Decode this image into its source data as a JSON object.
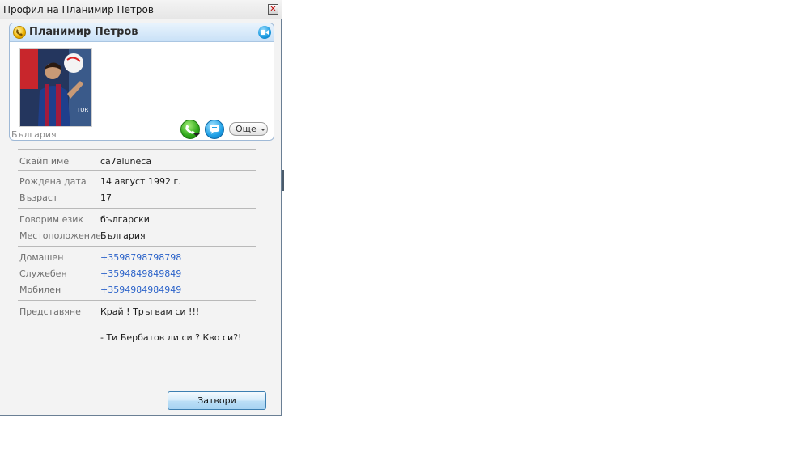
{
  "window": {
    "title": "Профил на Планимир Петров",
    "close_glyph": "✕"
  },
  "card": {
    "name": "Планимир Петров",
    "country": "България",
    "more_label": "Още",
    "status_icon": "phone-status-icon",
    "video_icon": "video-icon"
  },
  "fields": {
    "skype_name": {
      "label": "Скайп име",
      "value": "ca7aluneca"
    },
    "birth_date": {
      "label": "Рождена дата",
      "value": "14 август 1992 г."
    },
    "age": {
      "label": "Възраст",
      "value": "17"
    },
    "language": {
      "label": "Говорим език",
      "value": "български"
    },
    "location": {
      "label": "Местоположение",
      "value": "България"
    },
    "home_phone": {
      "label": "Домашен",
      "value": "+3598798798798"
    },
    "office_phone": {
      "label": "Служебен",
      "value": "+3594849849849"
    },
    "mobile_phone": {
      "label": "Мобилен",
      "value": "+3594984984949"
    },
    "intro": {
      "label": "Представяне",
      "line1": "Край ! Тръгвам си !!!",
      "line2": "- Ти Бербатов ли си ? Кво си?!"
    }
  },
  "footer": {
    "close_label": "Затвори"
  },
  "colors": {
    "link": "#2a62c9",
    "header_gradient_top": "#e8f3fd",
    "call_green": "#2fa81a",
    "chat_blue": "#1ea0e6"
  }
}
